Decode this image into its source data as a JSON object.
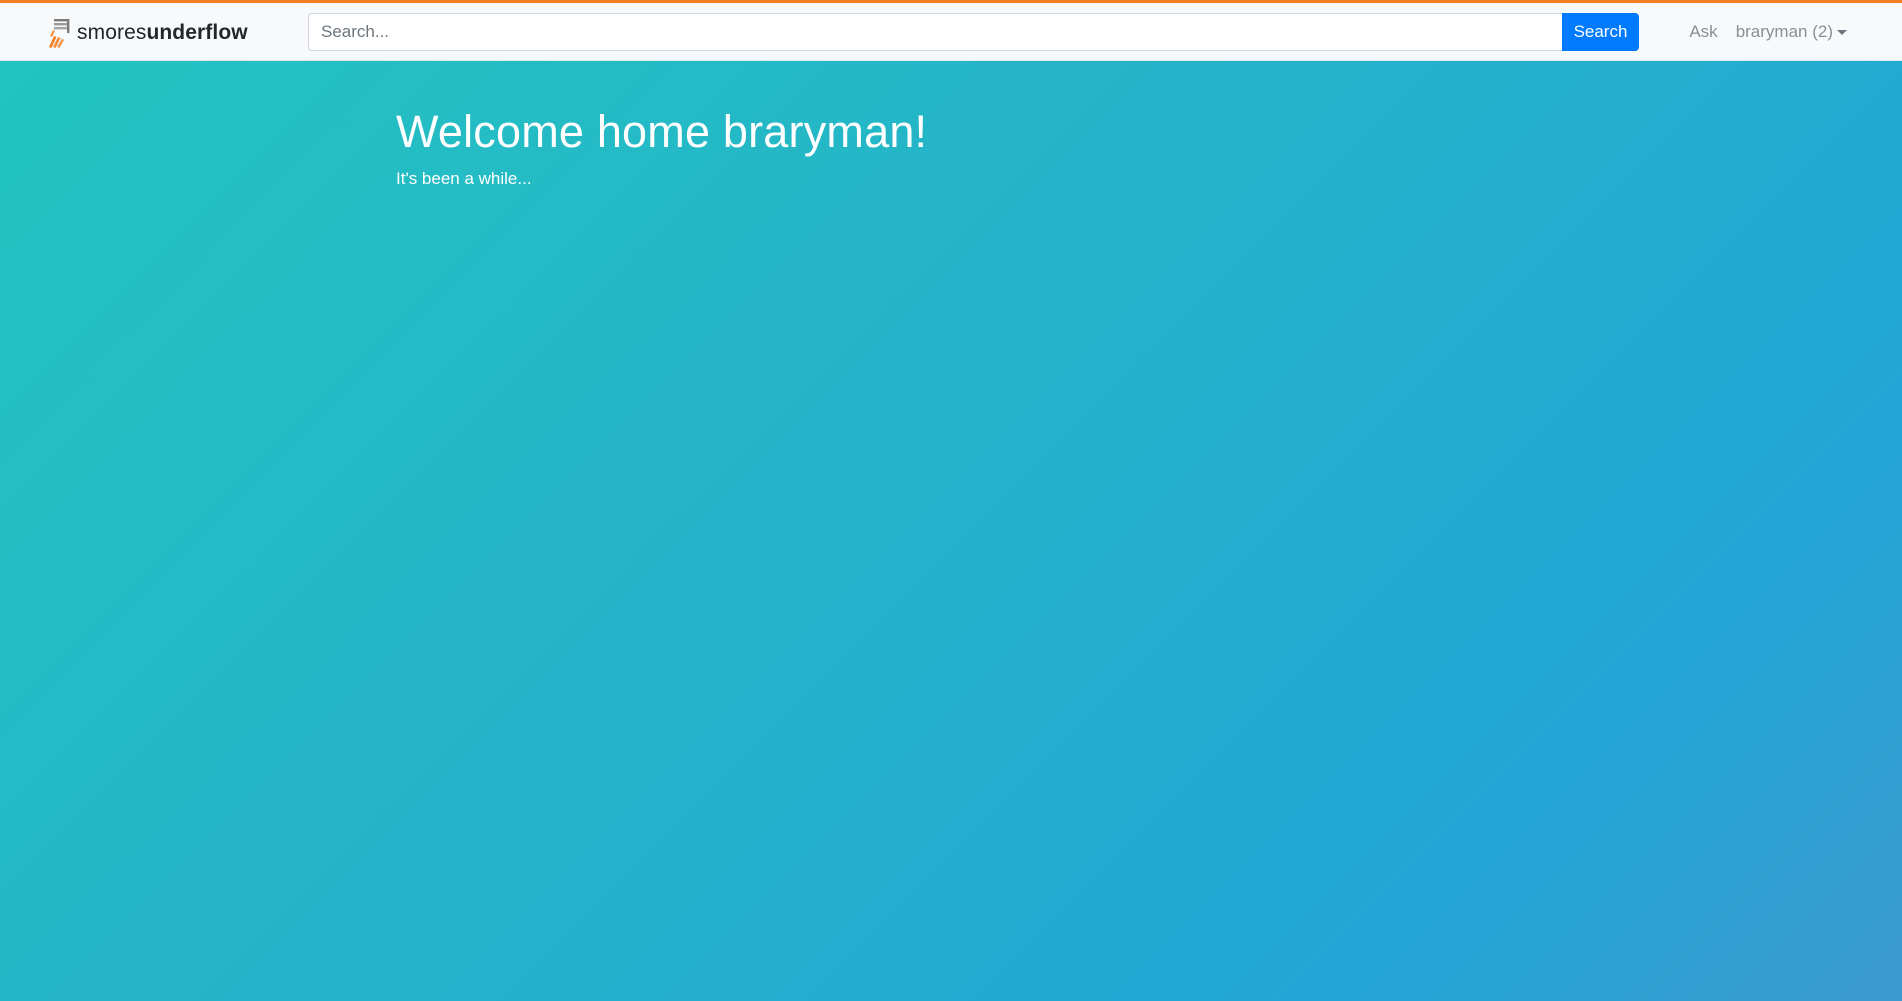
{
  "colors": {
    "accent_bar": "#f48024",
    "primary_button": "#007bff",
    "nav_text": "#8a8f93",
    "background_gradient": [
      "#23c4c1",
      "#24b5c8",
      "#22a6d6",
      "#3a99cf"
    ]
  },
  "header": {
    "brand": {
      "icon": "stack-logo-icon",
      "name_light": "smores",
      "name_bold": "underflow"
    },
    "search": {
      "placeholder": "Search...",
      "value": "",
      "button_label": "Search"
    },
    "nav": {
      "ask_label": "Ask",
      "user_label": "braryman (2)",
      "user_menu_icon": "caret-down-icon"
    }
  },
  "main": {
    "heading": "Welcome home braryman!",
    "subheading": "It's been a while..."
  }
}
